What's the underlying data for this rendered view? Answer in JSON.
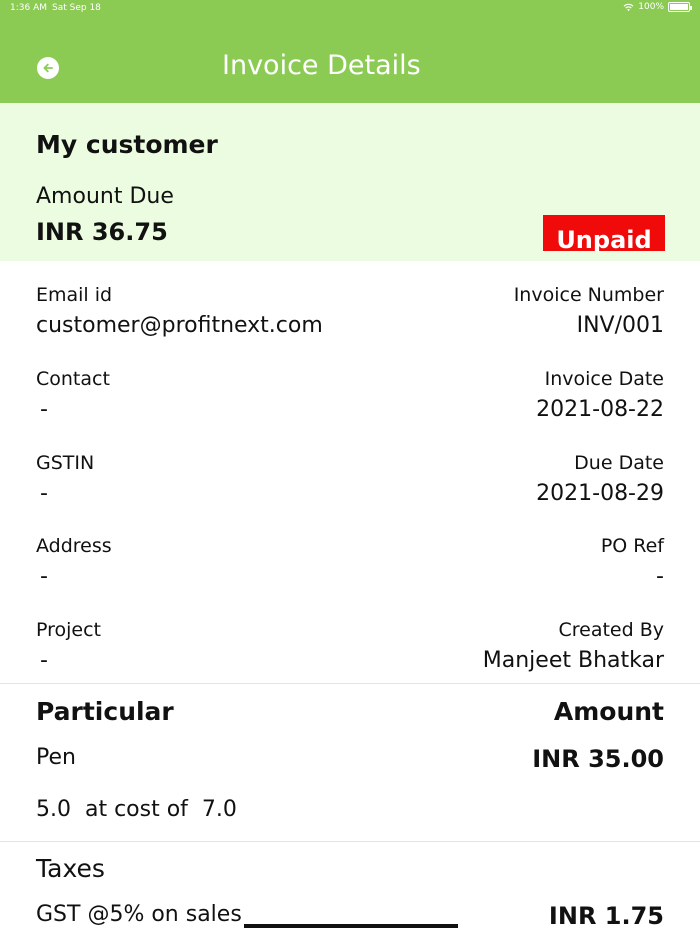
{
  "status_bar": {
    "time": "1:36 AM",
    "date": "Sat Sep 18",
    "battery_text": "100%",
    "battery_level": 1.0
  },
  "header": {
    "title": "Invoice Details",
    "back_icon": "back-arrow-icon"
  },
  "summary": {
    "customer_name": "My customer",
    "amount_due_label": "Amount Due",
    "amount_due_value": "INR 36.75",
    "status": "Unpaid"
  },
  "details": {
    "email_label": "Email id",
    "email_value": "customer@profitnext.com",
    "invoice_number_label": "Invoice Number",
    "invoice_number_value": "INV/001",
    "contact_label": "Contact",
    "contact_value": "-",
    "invoice_date_label": "Invoice Date",
    "invoice_date_value": "2021-08-22",
    "gstin_label": "GSTIN",
    "gstin_value": "-",
    "due_date_label": "Due Date",
    "due_date_value": "2021-08-29",
    "address_label": "Address",
    "address_value": "-",
    "po_ref_label": "PO Ref",
    "po_ref_value": "-",
    "project_label": "Project",
    "project_value": "-",
    "created_by_label": "Created By",
    "created_by_value": "Manjeet Bhatkar"
  },
  "particulars": {
    "header_left": "Particular",
    "header_right": "Amount",
    "items": [
      {
        "name": "Pen",
        "amount": "INR 35.00",
        "qty_text": "5.0  at cost of  7.0"
      }
    ]
  },
  "taxes": {
    "header": "Taxes",
    "rows": [
      {
        "label": "GST @5% on sales",
        "amount": "INR 1.75"
      }
    ]
  },
  "colors": {
    "app_bar": "#8bcb54",
    "summary_bg": "#ebfce1",
    "unpaid_badge": "#f00a0a"
  }
}
